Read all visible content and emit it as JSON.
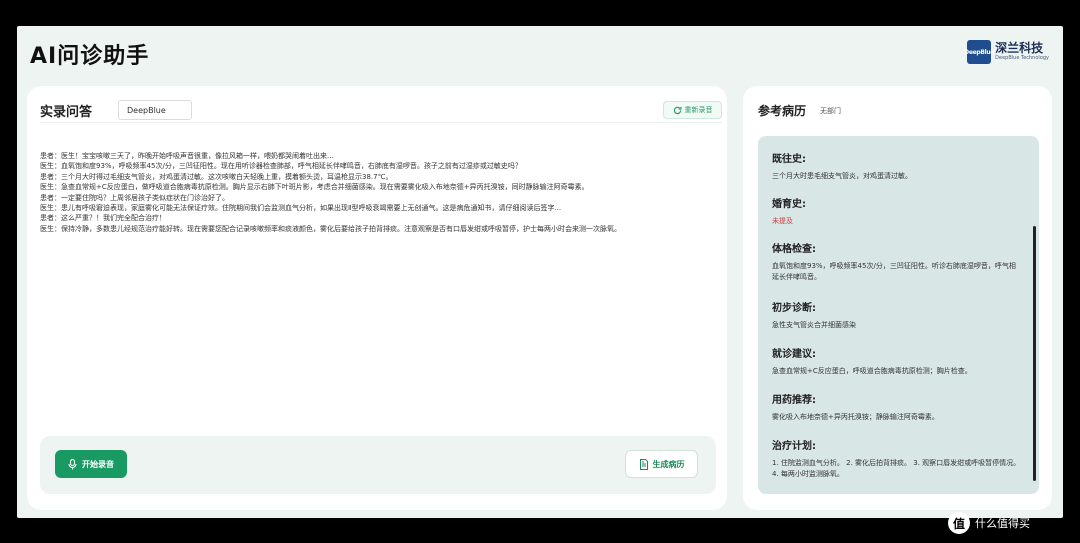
{
  "app": {
    "title": "AI问诊助手",
    "brand": {
      "logo_text": "DeepBlue",
      "name": "深兰科技",
      "sub": "DeepBlue Technology"
    }
  },
  "recording": {
    "title": "实录问答",
    "speaker_value": "DeepBlue",
    "rerecord_label": "重新录音",
    "start_label": "开始录音",
    "generate_label": "生成病历",
    "transcript": [
      "患者：医生！宝宝咳嗽三天了，昨晚开始呼吸声音很重，像拉风箱一样，喂奶都哭闹着吐出来...",
      "医生：血氧饱和度93%，呼吸频率45次/分，三凹征阳性。现在用听诊器检查肺部，呼气相延长伴哮鸣音，右肺底有湿啰音。孩子之前有过湿疹或过敏史吗？",
      "患者：三个月大时得过毛细支气管炎，对鸡蛋清过敏。这次咳嗽白天轻晚上重，摸着额头烫，耳温枪显示38.7℃。",
      "医生：急查血常规+C反应蛋白，做呼吸道合胞病毒抗原检测。胸片显示右肺下叶斑片影，考虑合并细菌感染。现在需要雾化吸入布地奈德+异丙托溴铵，同时静脉输注阿奇霉素。",
      "患者：一定要住院吗？上周邻居孩子类似症状在门诊治好了。",
      "医生：患儿有呼吸窘迫表现，家庭雾化可能无法保证疗效。住院期间我们会监测血气分析，如果出现Ⅱ型呼吸衰竭需要上无创通气。这是病危通知书，请仔细阅读后签字...",
      "患者：这么严重？！我们完全配合治疗！",
      "医生：保持冷静，多数患儿经规范治疗能好转。现在需要您配合记录咳嗽频率和痰液颜色，雾化后要给孩子拍背排痰。注意观察是否有口唇发绀或呼吸暂停，护士每两小时会来测一次脉氧。"
    ]
  },
  "record": {
    "title": "参考病历",
    "dept": "无部门",
    "sections": [
      {
        "heading": "既往史:",
        "value": "三个月大时患毛细支气管炎，对鸡蛋清过敏。",
        "warn": false
      },
      {
        "heading": "婚育史:",
        "value": "未提及",
        "warn": true
      },
      {
        "heading": "体格检查:",
        "value": "血氧饱和度93%，呼吸频率45次/分，三凹征阳性。听诊右肺底湿啰音，呼气相延长伴哮鸣音。",
        "warn": false
      },
      {
        "heading": "初步诊断:",
        "value": "急性支气管炎合并细菌感染",
        "warn": false
      },
      {
        "heading": "就诊建议:",
        "value": "急查血常规+C反应蛋白，呼吸道合胞病毒抗原检测；胸片检查。",
        "warn": false
      },
      {
        "heading": "用药推荐:",
        "value": "雾化吸入布地奈德+异丙托溴铵；静脉输注阿奇霉素。",
        "warn": false
      },
      {
        "heading": "治疗计划:",
        "value": "1. 住院监测血气分析。 2. 雾化后拍背排痰。 3. 观察口唇发绀或呼吸暂停情况。 4. 每两小时监测脉氧。",
        "warn": false
      }
    ]
  },
  "watermark": {
    "glyph": "值",
    "text": "什么值得买"
  },
  "colors": {
    "accent": "#1a9a63",
    "warn": "#d13b3b",
    "panel_bg": "#d9e6e6"
  },
  "icons": [
    "refresh-icon",
    "microphone-icon",
    "document-icon"
  ]
}
